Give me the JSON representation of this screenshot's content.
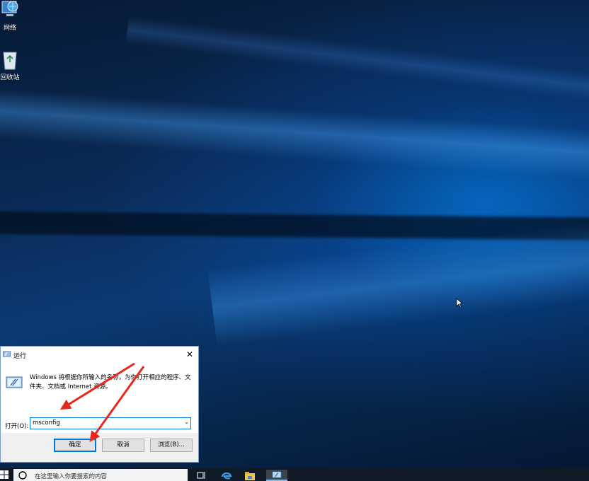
{
  "desktop": {
    "icons": [
      {
        "label": "网络",
        "icon": "network-icon"
      },
      {
        "label": "回收站",
        "icon": "recycle-bin-icon"
      }
    ]
  },
  "run_dialog": {
    "title": "运行",
    "description": "Windows 将根据你所输入的名称，为你打开相应的程序、文件夹、文档或 Internet 资源。",
    "open_label": "打开(O):",
    "input_value": "msconfig",
    "buttons": {
      "ok": "确定",
      "cancel": "取消",
      "browse": "浏览(B)..."
    },
    "close_glyph": "✕"
  },
  "taskbar": {
    "search_placeholder": "在这里输入你要搜索的内容",
    "apps": [
      "task-view-icon",
      "edge-icon",
      "file-explorer-icon",
      "run-app-icon"
    ]
  },
  "colors": {
    "accent": "#0078d7",
    "annotation_arrow": "#e8281e",
    "taskbar": "#101a26"
  }
}
